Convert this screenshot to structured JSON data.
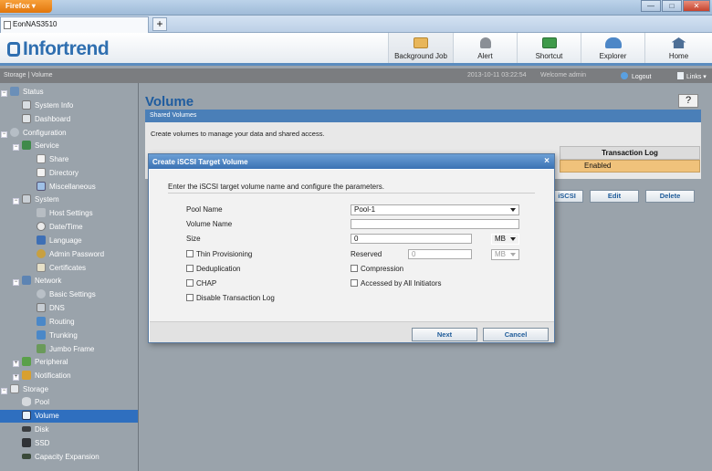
{
  "browser": {
    "menu_label": "Firefox ▾",
    "tab_title": "EonNAS3510",
    "new_tab": "+",
    "minimize": "—",
    "maximize": "□",
    "close": "✕"
  },
  "header": {
    "logo_text": "Infortrend",
    "nav": {
      "background_job": "Background Job",
      "alert": "Alert",
      "shortcut": "Shortcut",
      "explorer": "Explorer",
      "home": "Home"
    }
  },
  "statusbar": {
    "breadcrumb": "Storage | Volume",
    "timestamp": "2013-10-11 03:22:54",
    "welcome": "Welcome admin",
    "logout": "Logout",
    "links": "Links ▾"
  },
  "sidebar": {
    "status": "Status",
    "system_info": "System Info",
    "dashboard": "Dashboard",
    "configuration": "Configuration",
    "service": "Service",
    "share": "Share",
    "directory": "Directory",
    "miscellaneous": "Miscellaneous",
    "system": "System",
    "host_settings": "Host Settings",
    "date_time": "Date/Time",
    "language": "Language",
    "admin_password": "Admin Password",
    "certificates": "Certificates",
    "network": "Network",
    "basic_settings": "Basic Settings",
    "dns": "DNS",
    "routing": "Routing",
    "trunking": "Trunking",
    "jumbo_frame": "Jumbo Frame",
    "peripheral": "Peripheral",
    "notification": "Notification",
    "storage": "Storage",
    "pool": "Pool",
    "volume": "Volume",
    "disk": "Disk",
    "ssd": "SSD",
    "capacity_expansion": "Capacity Expansion"
  },
  "main": {
    "title": "Volume",
    "help": "?",
    "panel_title": "Shared Volumes",
    "panel_desc": "Create volumes to manage your data and shared access.",
    "column_transaction_log": "Transaction Log",
    "row_transaction_log": "Enabled",
    "btn_iscsi": "iSCSI",
    "btn_edit": "Edit",
    "btn_delete": "Delete"
  },
  "dialog": {
    "title": "Create iSCSI Target Volume",
    "close": "×",
    "intro": "Enter the iSCSI target volume name and configure the parameters.",
    "pool_name_label": "Pool Name",
    "pool_name_value": "Pool-1",
    "volume_name_label": "Volume Name",
    "volume_name_value": "",
    "size_label": "Size",
    "size_value": "0",
    "size_unit": "MB",
    "thin_provisioning": "Thin Provisioning",
    "reserved_label": "Reserved",
    "reserved_value": "0",
    "reserved_unit": "MB",
    "deduplication": "Deduplication",
    "compression": "Compression",
    "chap": "CHAP",
    "accessed_by_all": "Accessed by All Initiators",
    "disable_transaction_log": "Disable Transaction Log",
    "next": "Next",
    "cancel": "Cancel"
  },
  "colors": {
    "accent": "#3a72b4",
    "selected": "#2f6fbf",
    "highlight_row": "#f0c27b",
    "firefox_orange": "#e2760c"
  }
}
